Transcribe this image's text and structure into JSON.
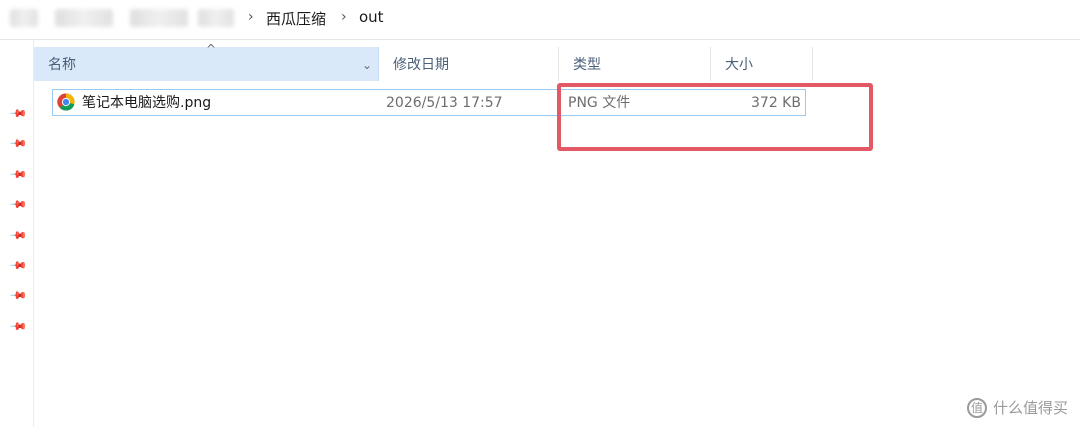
{
  "breadcrumb": {
    "separator": "›",
    "items": [
      "西瓜压缩",
      "out"
    ]
  },
  "columns": {
    "name": "名称",
    "date": "修改日期",
    "type": "类型",
    "size": "大小",
    "sort_arrow": "^",
    "chevron": "⌄"
  },
  "files": [
    {
      "name": "笔记本电脑选购.png",
      "modified": "2026/5/13 17:57",
      "type": "PNG 文件",
      "size": "372 KB",
      "icon": "chrome-icon"
    }
  ],
  "pins": [
    "📌",
    "📌",
    "📌",
    "📌",
    "📌",
    "📌",
    "📌",
    "📌"
  ],
  "annotation": {
    "color": "#e25864"
  },
  "watermark": {
    "badge": "值",
    "text": "什么值得买"
  },
  "colors": {
    "header_selected": "#d9e9f9",
    "row_border": "#99c9ef"
  }
}
